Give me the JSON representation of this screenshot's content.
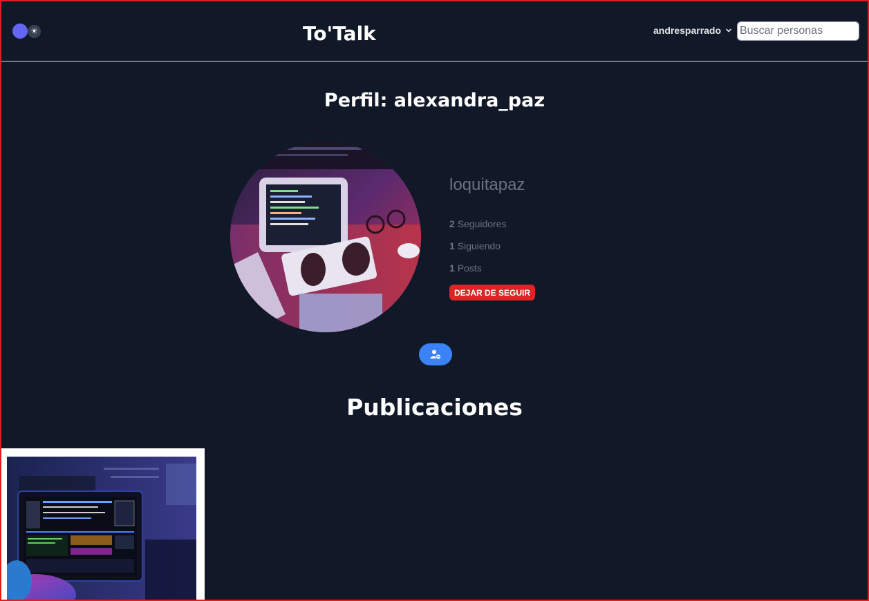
{
  "header": {
    "logo": "To'Talk",
    "user_menu_label": "andresparrado",
    "search_placeholder": "Buscar personas",
    "theme_toggle_icon": "sun-icon"
  },
  "profile": {
    "title": "Perfil: alexandra_paz",
    "display_name": "loquitapaz",
    "followers_count": "2",
    "followers_label": "Seguidores",
    "following_count": "1",
    "following_label": "Siguiendo",
    "posts_count": "1",
    "posts_label": "Posts",
    "unfollow_label": "DEJAR DE SEGUIR",
    "action_icon": "user-minus-icon"
  },
  "posts_section": {
    "title": "Publicaciones",
    "posts": [
      {
        "image": "computer-monitor-photo"
      }
    ]
  },
  "colors": {
    "background": "#111827",
    "accent_toggle": "#6366f1",
    "unfollow_button": "#dc2626",
    "action_button": "#3b82f6"
  }
}
